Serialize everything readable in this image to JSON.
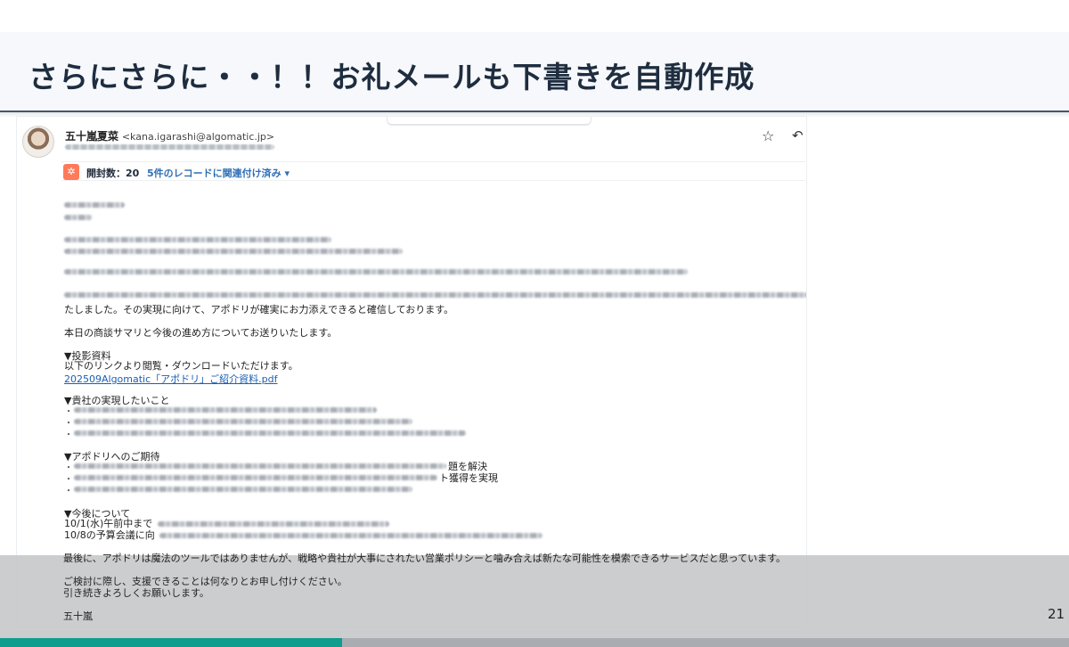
{
  "slide": {
    "title": "さらにさらに・・！！お礼メールも下書きを自動作成",
    "page_number": "21",
    "progress_fraction": 0.32,
    "colors": {
      "title": "#1e2d3f",
      "accent": "#0f9d8e",
      "link": "#1a5fb4",
      "hubspot": "#ff7a59"
    }
  },
  "email": {
    "sender_name": "五十嵐夏菜",
    "sender_email": "<kana.igarashi@algomatic.jp>",
    "icons": {
      "star": "star-icon",
      "reply": "reply-icon",
      "avatar": "avatar",
      "hubspot": "hubspot-sprocket-icon"
    },
    "hubspot": {
      "open_count": "開封数：20",
      "records_link": "5件のレコードに関連付け済み ▾"
    },
    "body": {
      "line_implementation": "たしました。その実現に向けて、アポドリが確実にお力添えできると確信しております。",
      "line_summary": "本日の商談サマリと今後の進め方についてお送りいたします。",
      "section_materials": "▼投影資料",
      "materials_desc": "以下のリンクより閲覧・ダウンロードいただけます。",
      "materials_link": "202509Algomatic「アポドリ」ご紹介資料.pdf",
      "section_goals": "▼貴社の実現したいこと",
      "section_expectations": "▼アポドリへのご期待",
      "expectation_1_tail": "題を解決",
      "expectation_2_tail": "ト獲得を実現",
      "section_next": "▼今後について",
      "next_1": "10/1(水)午前中まで",
      "next_2": "10/8の予算会議に向",
      "closing_1": "最後に、アポドリは魔法のツールではありませんが、戦略や貴社が大事にされたい営業ポリシーと噛み合えば新たな可能性を模索できるサービスだと思っています。",
      "closing_2": "ご検討に際し、支援できることは何なりとお申し付けください。",
      "closing_3": "引き続きよろしくお願いします。",
      "signature": "五十嵐"
    }
  }
}
